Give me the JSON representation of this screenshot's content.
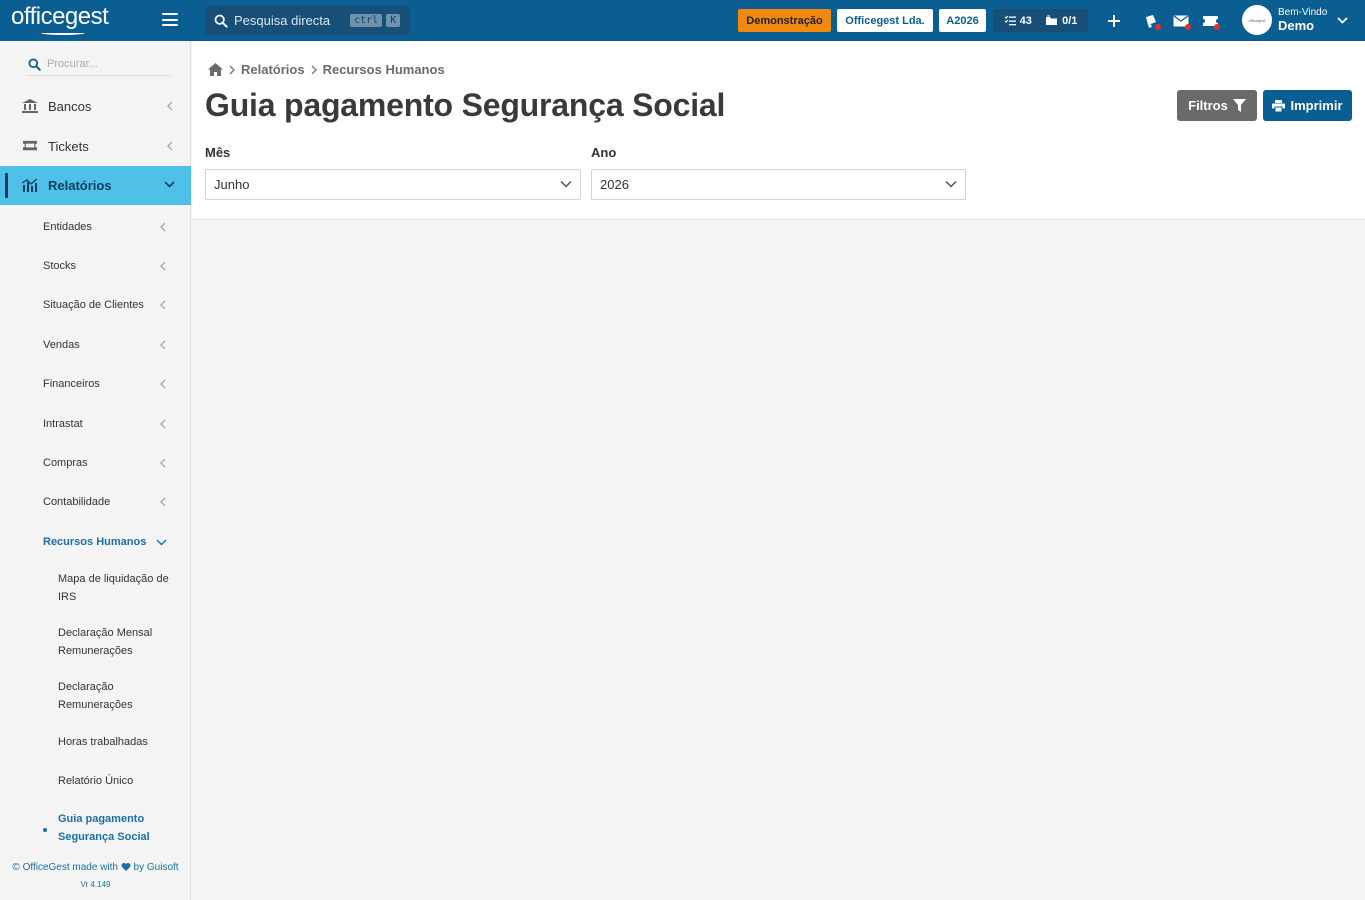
{
  "topbar": {
    "logo": "officegest",
    "search_placeholder": "Pesquisa directa",
    "shortcut_ctrl": "ctrl",
    "shortcut_k": "K",
    "badge_demo": "Demonstração",
    "badge_company": "Officegest Lda.",
    "badge_year": "A2026",
    "tasks_count": "43",
    "folders_count": "0/1",
    "welcome": "Bem-Vindo",
    "user_name": "Demo",
    "avatar_text": "officegest"
  },
  "sidebar": {
    "search_placeholder": "Procurar...",
    "menu": [
      {
        "label": "Bancos",
        "icon": "bank-icon"
      },
      {
        "label": "Tickets",
        "icon": "ticket-icon"
      },
      {
        "label": "Relatórios",
        "icon": "chart-icon"
      }
    ],
    "submenu": [
      "Entidades",
      "Stocks",
      "Situação de Clientes",
      "Vendas",
      "Financeiros",
      "Intrastat",
      "Compras",
      "Contabilidade",
      "Recursos Humanos"
    ],
    "leaves": [
      "Mapa de liquidação de IRS",
      "Declaração Mensal Remunerações",
      "Declaração Remunerações",
      "Horas trabalhadas",
      "Relatório Único",
      "Guia pagamento Segurança Social"
    ],
    "footer_left": "© OfficeGest made with",
    "footer_right": "by Guisoft",
    "version": "Vr 4.149"
  },
  "main": {
    "breadcrumb": [
      "Relatórios",
      "Recursos Humanos"
    ],
    "title": "Guia pagamento Segurança Social",
    "filter_label": "Filtros",
    "print_label": "Imprimir",
    "month_label": "Mês",
    "month_value": "Junho",
    "year_label": "Ano",
    "year_value": "2026"
  },
  "colors": {
    "primary": "#0b5e91",
    "accent": "#4fc1e8",
    "demo": "#f0890e"
  }
}
